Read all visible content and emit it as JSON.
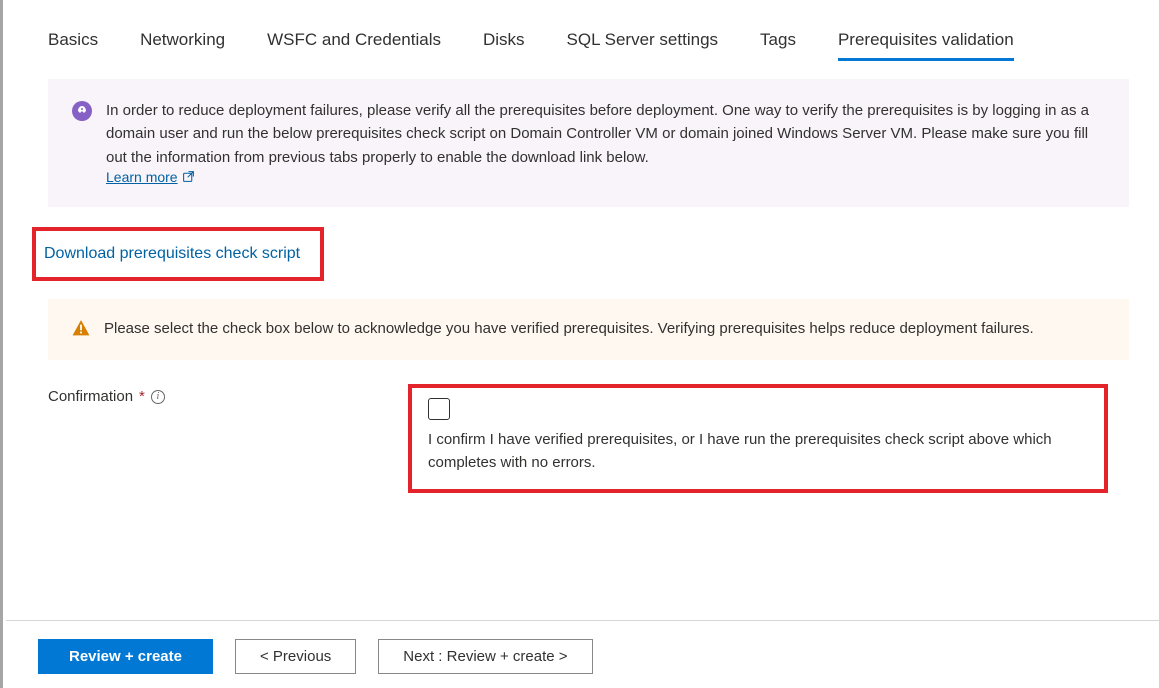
{
  "tabs": [
    {
      "label": "Basics"
    },
    {
      "label": "Networking"
    },
    {
      "label": "WSFC and Credentials"
    },
    {
      "label": "Disks"
    },
    {
      "label": "SQL Server settings"
    },
    {
      "label": "Tags"
    },
    {
      "label": "Prerequisites validation",
      "active": true
    }
  ],
  "info_banner": {
    "text": "In order to reduce deployment failures, please verify all the prerequisites before deployment. One way to verify the prerequisites is by logging in as a domain user and run the below prerequisites check script on Domain Controller VM or domain joined Windows Server VM. Please make sure you fill out the information from previous tabs properly to enable the download link below.",
    "learn_more": "Learn more"
  },
  "download_link": "Download prerequisites check script",
  "warning_banner": {
    "text": "Please select the check box below to acknowledge you have verified prerequisites. Verifying prerequisites helps reduce deployment failures."
  },
  "confirmation": {
    "label": "Confirmation",
    "required_marker": "*",
    "checkbox_text": "I confirm I have verified prerequisites, or I have run the prerequisites check script above which completes with no errors."
  },
  "footer": {
    "review_create": "Review + create",
    "previous": "< Previous",
    "next": "Next : Review + create >"
  }
}
